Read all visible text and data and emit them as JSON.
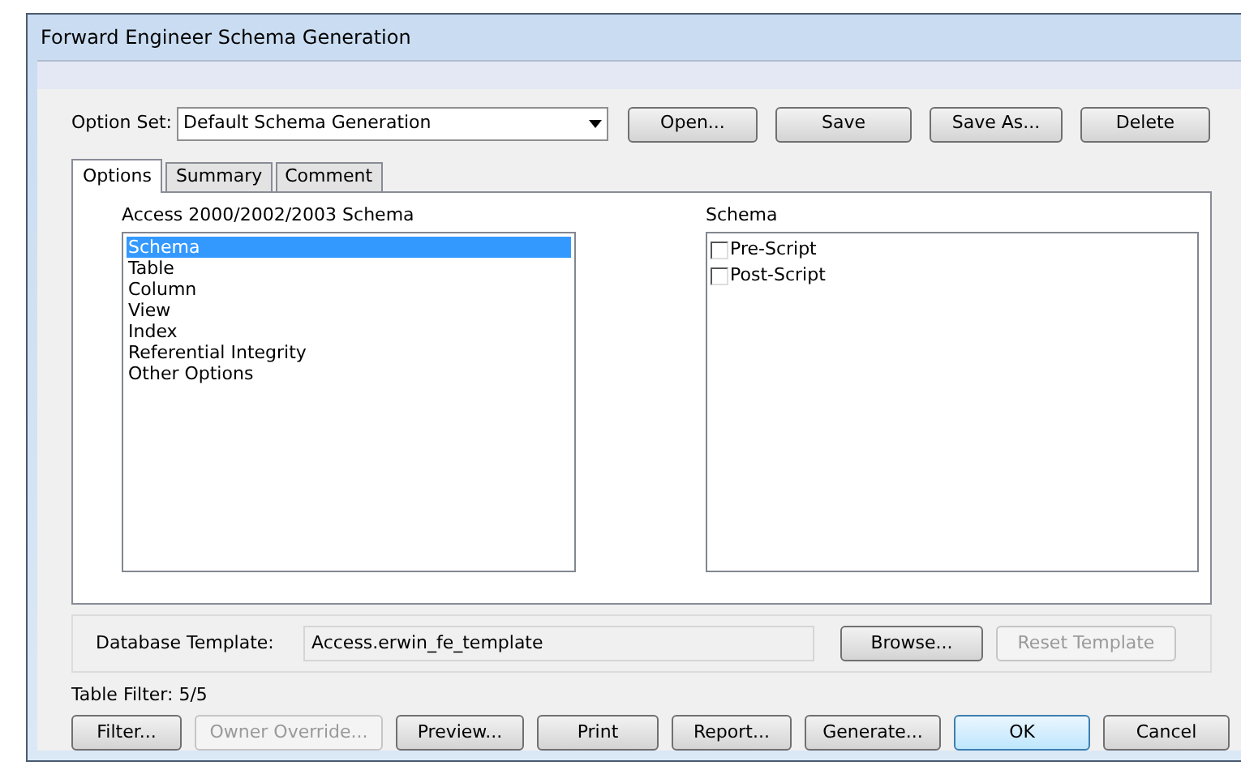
{
  "window": {
    "title": "Forward Engineer Schema Generation"
  },
  "option_set": {
    "label": "Option Set:",
    "value": "Default Schema Generation",
    "buttons": [
      {
        "label": "Open...",
        "disabled": false
      },
      {
        "label": "Save",
        "disabled": false
      },
      {
        "label": "Save As...",
        "disabled": false
      },
      {
        "label": "Delete",
        "disabled": false
      }
    ]
  },
  "tabs": [
    {
      "label": "Options",
      "selected": true
    },
    {
      "label": "Summary",
      "selected": false
    },
    {
      "label": "Comment",
      "selected": false
    }
  ],
  "left_list": {
    "heading": "Access 2000/2002/2003 Schema",
    "items": [
      {
        "label": "Schema",
        "selected": true
      },
      {
        "label": "Table",
        "selected": false
      },
      {
        "label": "Column",
        "selected": false
      },
      {
        "label": "View",
        "selected": false
      },
      {
        "label": "Index",
        "selected": false
      },
      {
        "label": "Referential Integrity",
        "selected": false
      },
      {
        "label": "Other Options",
        "selected": false
      }
    ]
  },
  "right_list": {
    "heading": "Schema",
    "items": [
      {
        "label": "Pre-Script",
        "checked": false
      },
      {
        "label": "Post-Script",
        "checked": false
      }
    ]
  },
  "template": {
    "label": "Database Template:",
    "value": "Access.erwin_fe_template",
    "buttons": [
      {
        "label": "Browse...",
        "disabled": false
      },
      {
        "label": "Reset Template",
        "disabled": true
      }
    ]
  },
  "table_filter": "Table Filter: 5/5",
  "buttons": [
    {
      "label": "Filter...",
      "disabled": false,
      "default": false
    },
    {
      "label": "Owner Override...",
      "disabled": true,
      "default": false
    },
    {
      "label": "Preview...",
      "disabled": false,
      "default": false
    },
    {
      "label": "Print",
      "disabled": false,
      "default": false
    },
    {
      "label": "Report...",
      "disabled": false,
      "default": false
    },
    {
      "label": "Generate...",
      "disabled": false,
      "default": false
    },
    {
      "label": "OK",
      "disabled": false,
      "default": true
    },
    {
      "label": "Cancel",
      "disabled": false,
      "default": false
    }
  ]
}
